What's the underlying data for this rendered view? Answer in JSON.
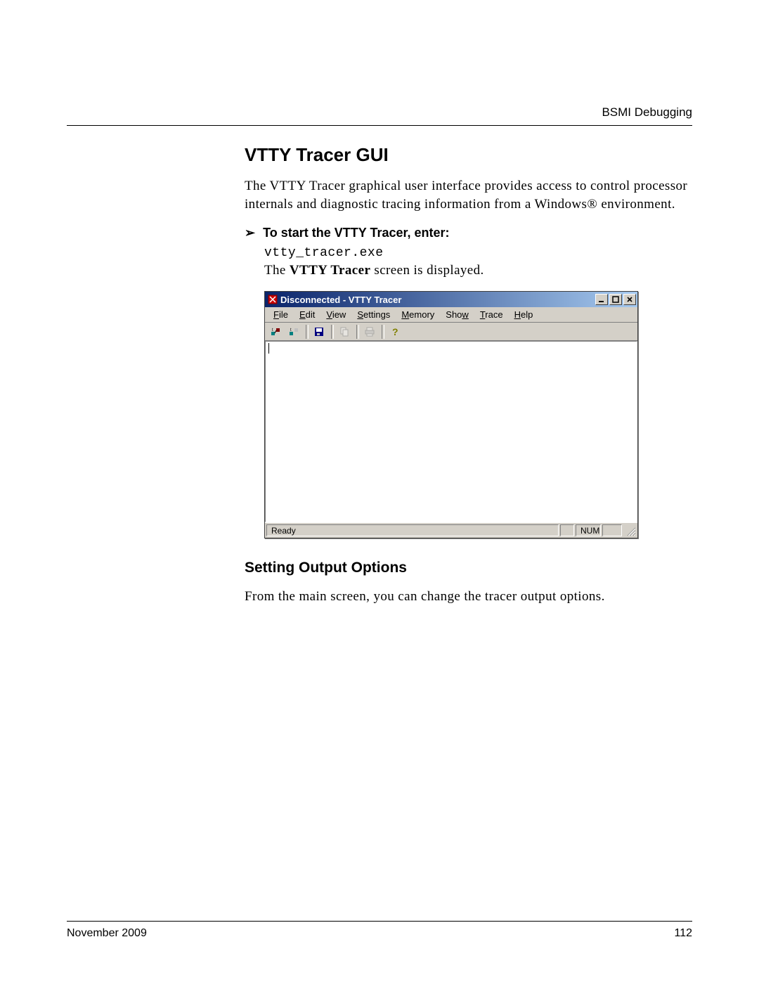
{
  "header": {
    "right": "BSMI Debugging"
  },
  "section1": {
    "title": "VTTY Tracer GUI",
    "intro": "The VTTY Tracer graphical user interface provides access to control processor internals and diagnostic tracing information from a Windows® environment.",
    "instruction_label": "To start the VTTY Tracer, enter:",
    "command": "vtty_tracer.exe",
    "result_prefix": "The ",
    "result_bold": "VTTY Tracer",
    "result_suffix": " screen is displayed."
  },
  "window": {
    "title": "Disconnected - VTTY Tracer",
    "menus": [
      {
        "u": "F",
        "rest": "ile"
      },
      {
        "u": "E",
        "rest": "dit"
      },
      {
        "u": "V",
        "rest": "iew"
      },
      {
        "u": "S",
        "rest": "ettings"
      },
      {
        "u": "M",
        "rest": "emory"
      },
      {
        "pre": "Sho",
        "u": "w",
        "rest": ""
      },
      {
        "u": "T",
        "rest": "race"
      },
      {
        "u": "H",
        "rest": "elp"
      }
    ],
    "status_ready": "Ready",
    "status_num": "NUM"
  },
  "section2": {
    "title": "Setting Output Options",
    "body": "From the main screen, you can change the tracer output options."
  },
  "footer": {
    "left": "November 2009",
    "right": "112"
  }
}
